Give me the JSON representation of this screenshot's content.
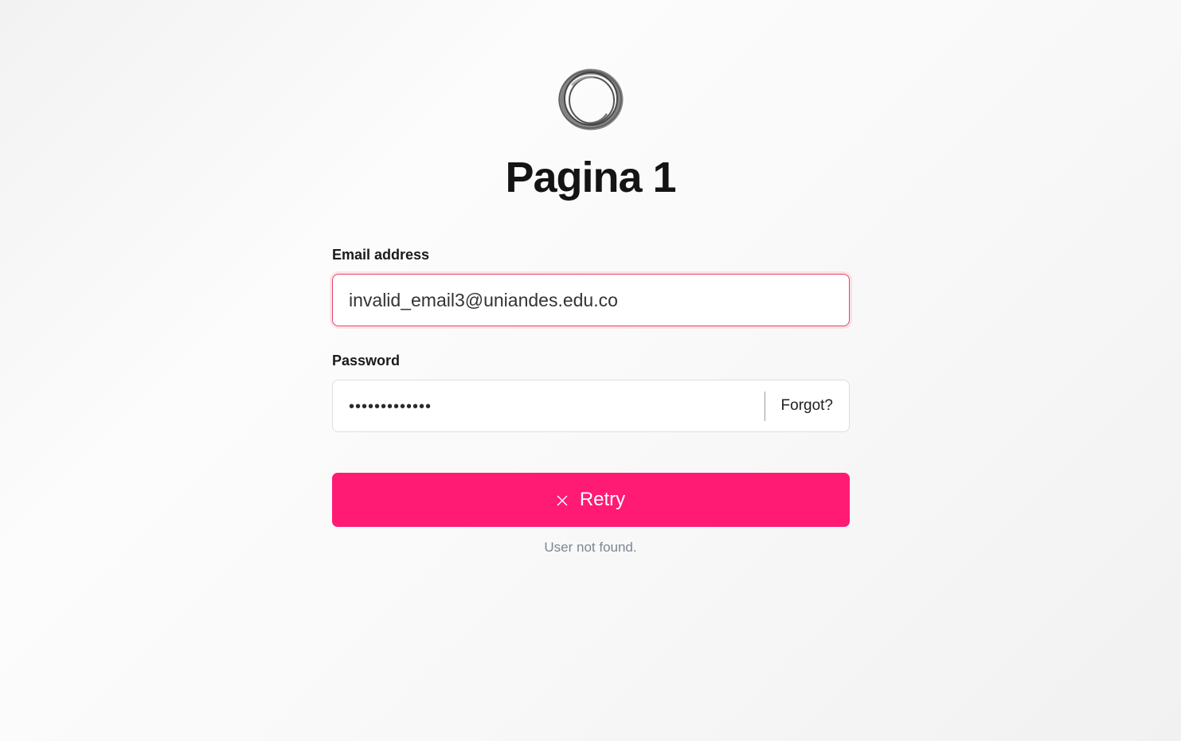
{
  "app": {
    "title": "Pagina 1",
    "logo_icon": "ring-logo-icon"
  },
  "form": {
    "email": {
      "label": "Email address",
      "value": "invalid_email3@uniandes.edu.co",
      "state": "error"
    },
    "password": {
      "label": "Password",
      "masked_value": "•••••••••••••",
      "forgot_label": "Forgot?"
    },
    "submit": {
      "label": "Retry",
      "icon": "close-icon"
    },
    "status_message": "User not found."
  },
  "colors": {
    "accent": "#ff1a74",
    "error_border": "#e5466b",
    "status_text": "#7d8590"
  }
}
